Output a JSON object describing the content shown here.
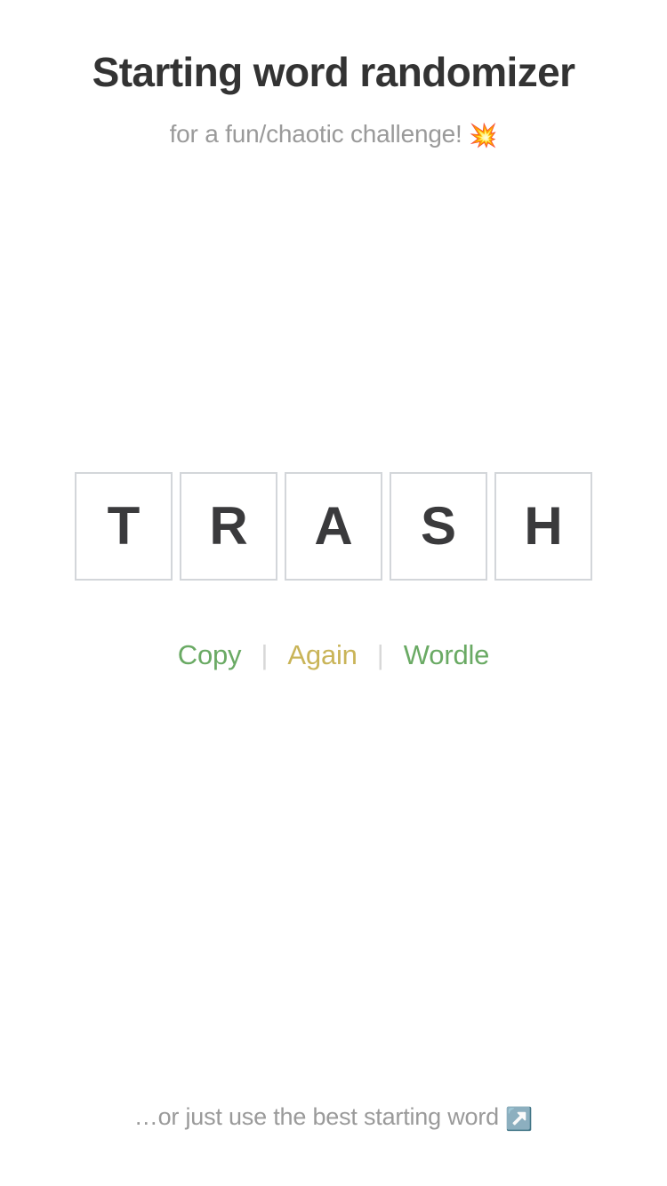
{
  "header": {
    "title": "Starting word randomizer",
    "subtitle": "for a fun/chaotic challenge!",
    "subtitle_emoji": "💥",
    "title_color": "#333333",
    "subtitle_color": "#9a9a9a"
  },
  "word": {
    "value": "TRASH",
    "letters": [
      "T",
      "R",
      "A",
      "S",
      "H"
    ],
    "tile_border_color": "#d3d6da",
    "letter_color": "#3a3a3c"
  },
  "actions": {
    "separator": "|",
    "links": [
      {
        "label": "Copy",
        "color": "#6aaa64"
      },
      {
        "label": "Again",
        "color": "#c9b458"
      },
      {
        "label": "Wordle",
        "color": "#6aaa64"
      }
    ]
  },
  "footer": {
    "text": "…or just use the best starting word",
    "emoji": "↗️",
    "color": "#9a9a9a"
  }
}
